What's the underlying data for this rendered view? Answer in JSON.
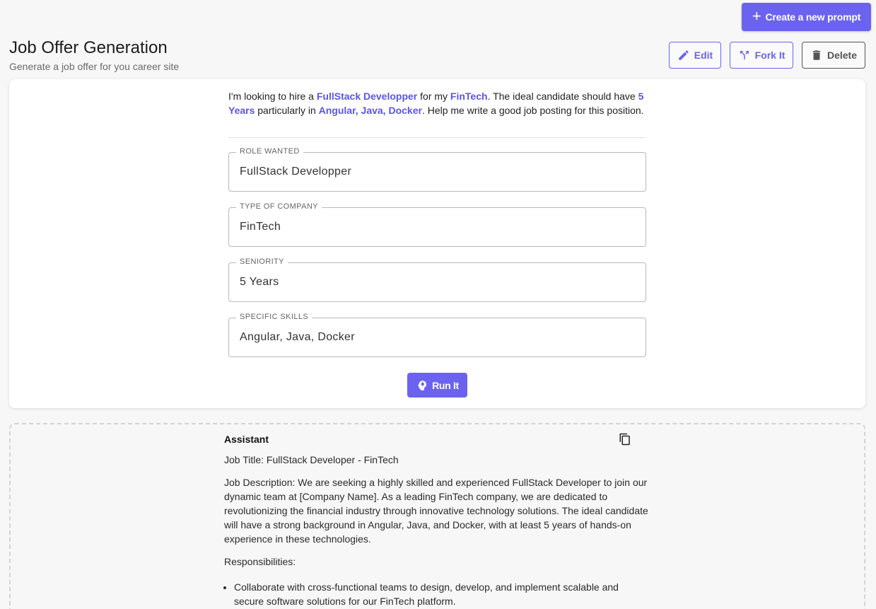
{
  "header": {
    "create_label": "Create a new prompt",
    "title": "Job Offer Generation",
    "subtitle": "Generate a job offer for you career site",
    "edit_label": "Edit",
    "fork_label": "Fork It",
    "delete_label": "Delete"
  },
  "prompt": {
    "t1": "I'm looking to hire a ",
    "role": "FullStack Developper",
    "t2": " for my ",
    "company": "FinTech",
    "t3": ". The ideal candidate should have ",
    "seniority": "5 Years",
    "t4": " particularly in ",
    "skills": "Angular, Java, Docker",
    "t5": ". Help me write a good job posting for this position."
  },
  "fields": [
    {
      "label": "ROLE WANTED",
      "value": "FullStack Developper"
    },
    {
      "label": "TYPE OF COMPANY",
      "value": "FinTech"
    },
    {
      "label": "SENIORITY",
      "value": "5 Years"
    },
    {
      "label": "SPECIFIC SKILLS",
      "value": "Angular, Java, Docker"
    }
  ],
  "run_label": "Run It",
  "result": {
    "speaker": "Assistant",
    "job_title": "Job Title: FullStack Developer - FinTech",
    "description": "Job Description: We are seeking a highly skilled and experienced FullStack Developer to join our dynamic team at [Company Name]. As a leading FinTech company, we are dedicated to revolutionizing the financial industry through innovative technology solutions. The ideal candidate will have a strong background in Angular, Java, and Docker, with at least 5 years of hands-on experience in these technologies.",
    "responsibilities_heading": "Responsibilities:",
    "responsibilities": [
      "Collaborate with cross-functional teams to design, develop, and implement scalable and secure software solutions for our FinTech platform."
    ]
  },
  "colors": {
    "accent": "#6b63f0",
    "highlight": "#5b55e8"
  },
  "icons": {
    "create": "plus-icon",
    "edit": "pencil-icon",
    "fork": "fork-icon",
    "delete": "trash-icon",
    "run": "brain-head-icon",
    "copy": "copy-icon"
  }
}
